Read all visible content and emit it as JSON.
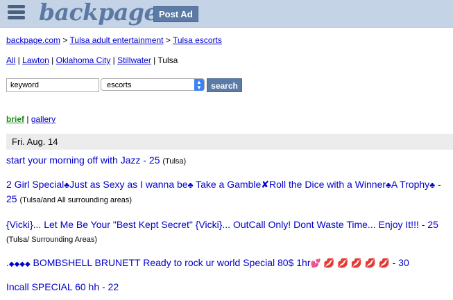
{
  "header": {
    "logo": "backpage",
    "post_ad": "Post Ad"
  },
  "breadcrumb": {
    "items": [
      "backpage.com",
      "Tulsa adult entertainment",
      "Tulsa escorts"
    ],
    "sep": " > "
  },
  "cities": {
    "links": [
      "All",
      "Lawton",
      "Oklahoma City",
      "Stillwater"
    ],
    "current": "Tulsa",
    "sep": " | "
  },
  "search": {
    "keyword_value": "keyword",
    "category_value": "escorts",
    "button_label": "search"
  },
  "view": {
    "brief": "brief",
    "gallery": "gallery",
    "sep": " | "
  },
  "date_heading": "Fri. Aug. 14",
  "listings": [
    {
      "title": "start your morning off with Jazz - 25",
      "location": "(Tulsa)"
    },
    {
      "title_parts": [
        "2 Girl Special",
        "Just as Sexy as I wanna be",
        " Take a Gamble",
        "Roll the Dice with a Winner",
        "A Trophy",
        " - 25"
      ],
      "location": "(Tulsa/and All surrounding areas)"
    },
    {
      "title": "{Vicki}... Let Me Be Your \"Best Kept Secret\" {Vicki}... OutCall Only! Dont Waste Time... Enjoy It!!! - 25",
      "location": "(Tulsa/ Surrounding Areas)"
    },
    {
      "title_parts": [
        ".",
        " BOMBSHELL BRUNETT Ready to rock ur world Special 80$ 1hr",
        " - 30"
      ]
    },
    {
      "title": "Incall SPECIAL 60 hh - 22"
    }
  ],
  "glyphs": {
    "clover": "♣",
    "cross": "✘",
    "diamonds": "◆◆◆◆",
    "heart": "💕",
    "lips": "💋 💋 💋 💋 💋"
  }
}
